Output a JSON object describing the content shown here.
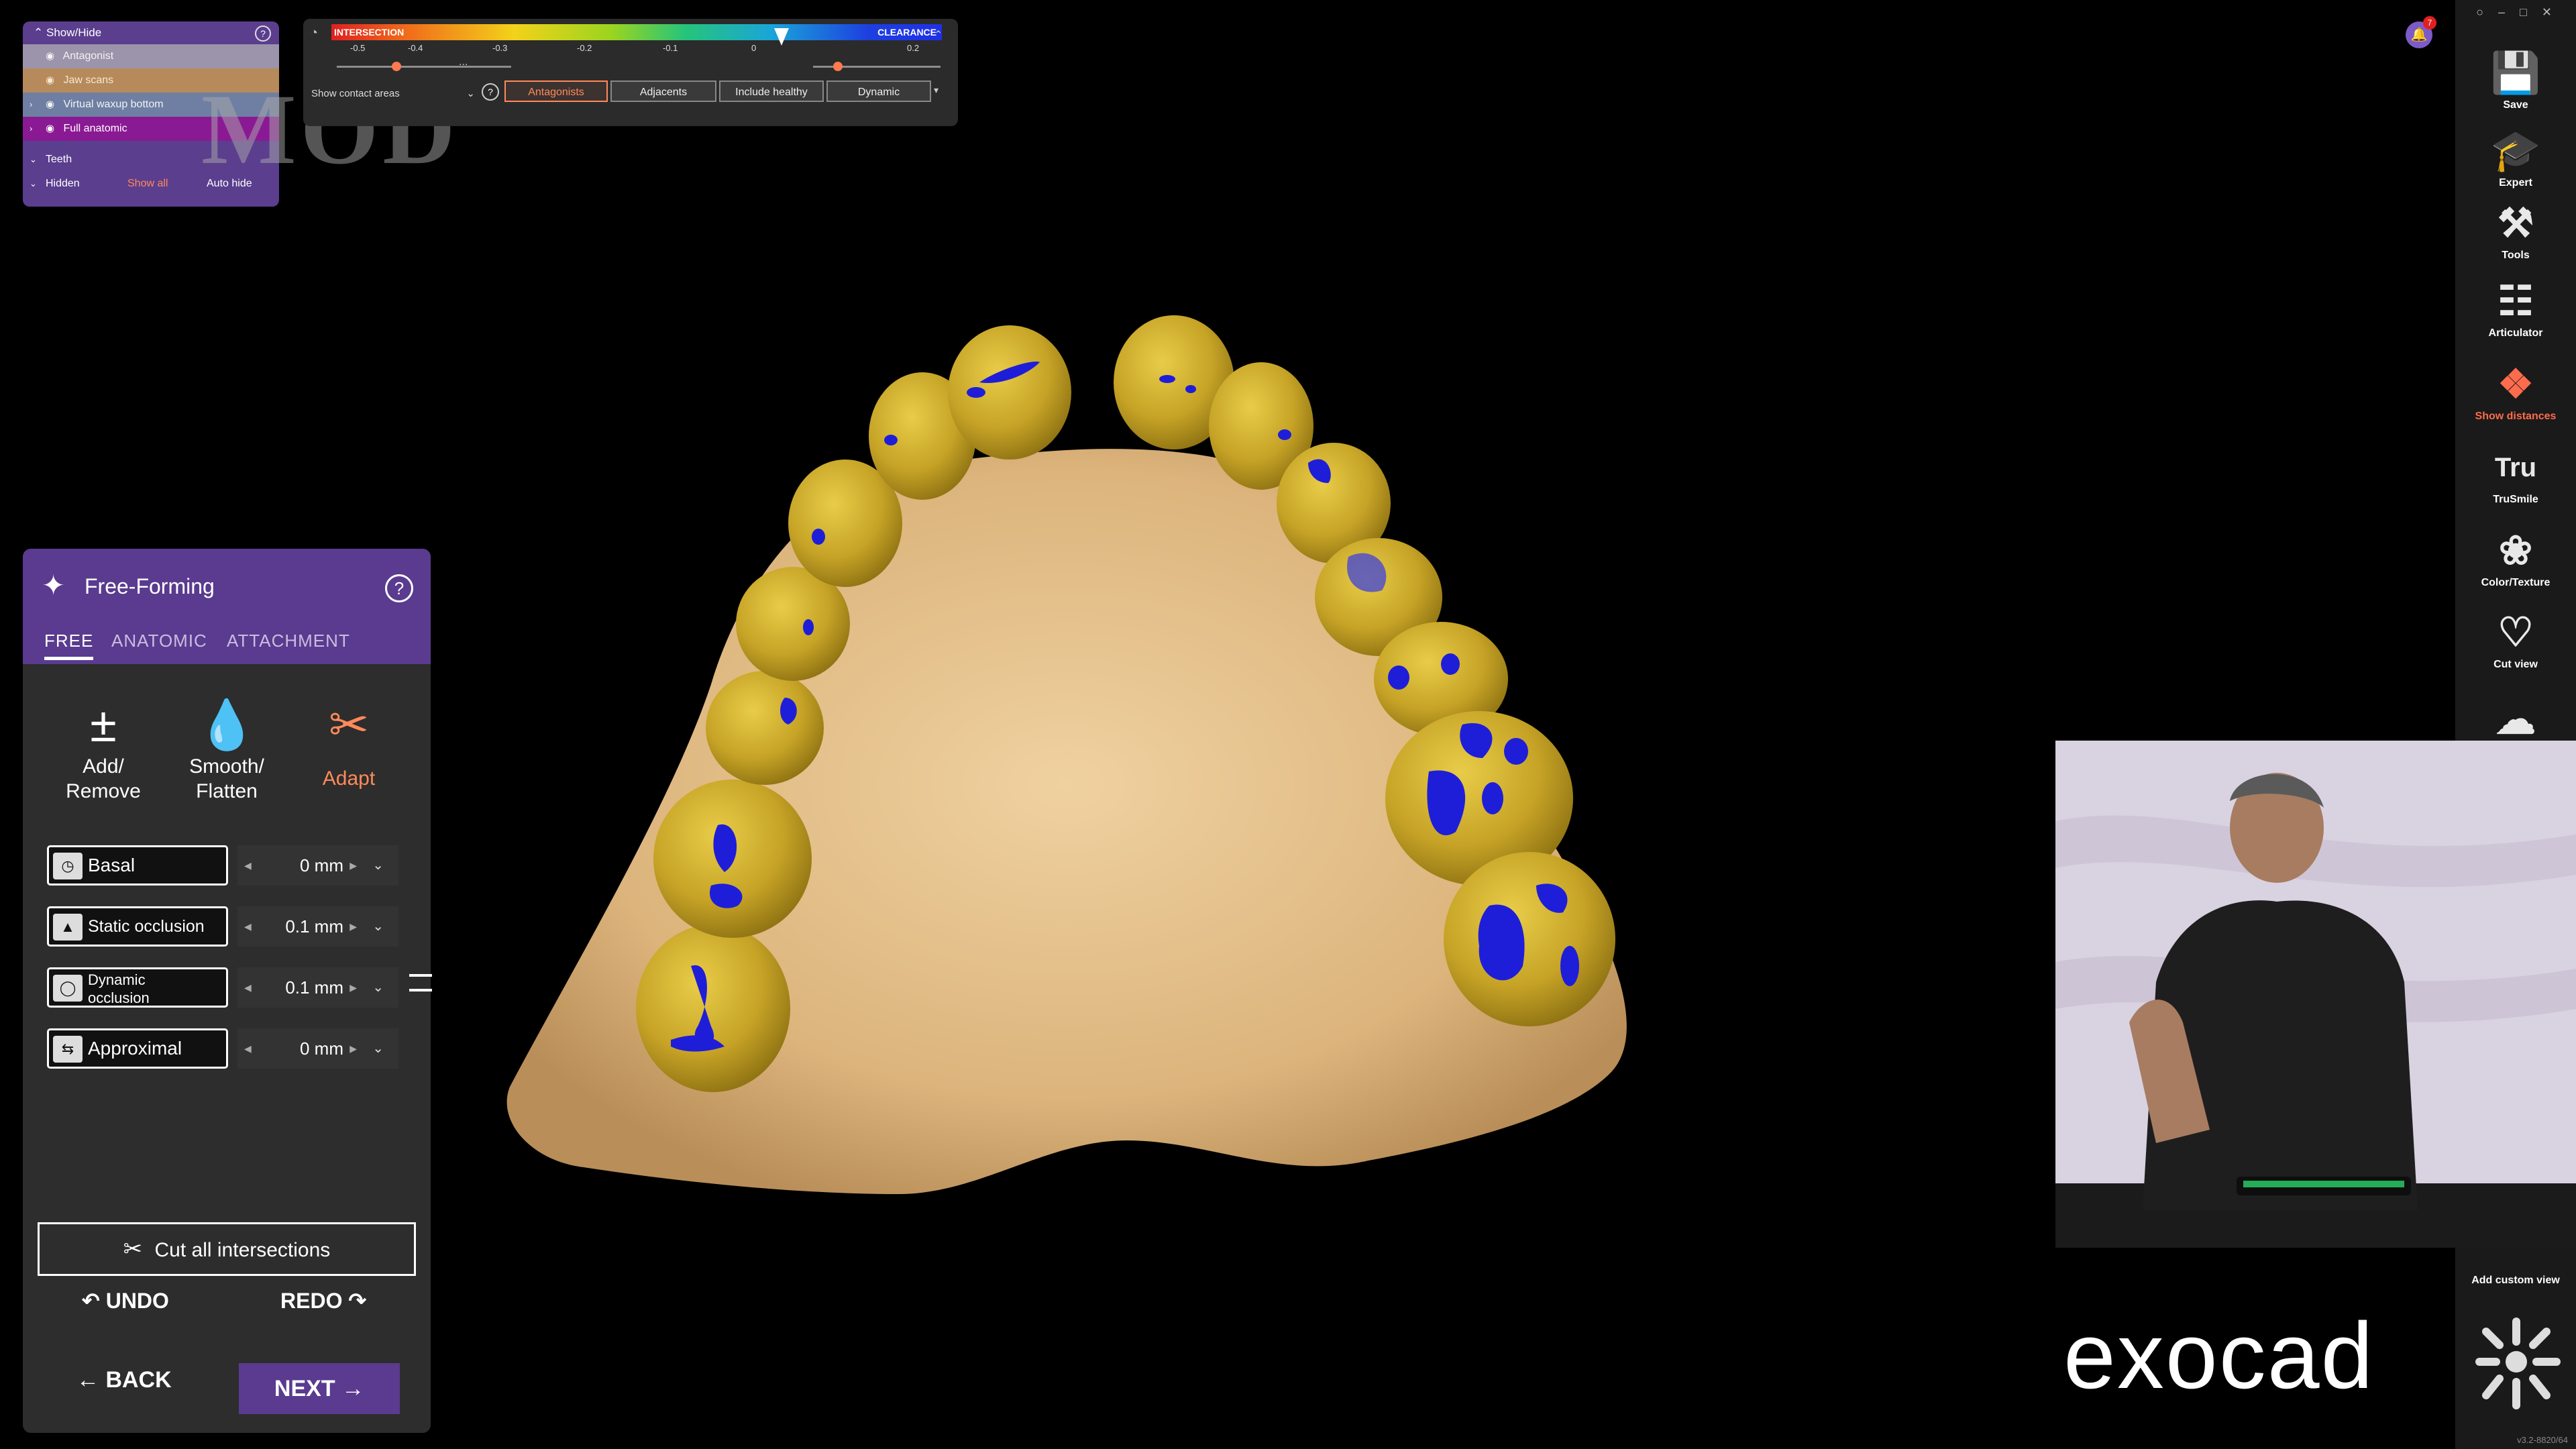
{
  "show_hide": {
    "title": "Show/Hide",
    "items": [
      {
        "label": "Antagonist"
      },
      {
        "label": "Jaw scans"
      },
      {
        "label": "Virtual waxup bottom"
      },
      {
        "label": "Full anatomic"
      }
    ],
    "teeth_label": "Teeth",
    "hidden_label": "Hidden",
    "show_all": "Show all",
    "auto_hide": "Auto hide"
  },
  "watermark": "MOD",
  "distance_bar": {
    "left_label": "INTERSECTION",
    "right_label": "CLEARANCE",
    "ticks": [
      "-0.5",
      "-0.4",
      "-0.3",
      "-0.2",
      "-0.1",
      "0",
      "0.2"
    ],
    "ellipsis": "...",
    "contact_select": "Show contact areas",
    "buttons": [
      "Antagonists",
      "Adjacents",
      "Include healthy",
      "Dynamic"
    ],
    "active_button": "Antagonists"
  },
  "free_forming": {
    "title": "Free-Forming",
    "tabs": [
      "FREE",
      "ANATOMIC",
      "ATTACHMENT"
    ],
    "active_tab": "FREE",
    "tools": [
      {
        "line1": "Add/",
        "line2": "Remove"
      },
      {
        "line1": "Smooth/",
        "line2": "Flatten"
      },
      {
        "line1": "Adapt",
        "line2": ""
      }
    ],
    "params": [
      {
        "label": "Basal",
        "value": "0 mm"
      },
      {
        "label": "Static occlusion",
        "value": "0.1 mm"
      },
      {
        "label_line1": "Dynamic",
        "label_line2": "occlusion",
        "value": "0.1 mm"
      },
      {
        "label": "Approximal",
        "value": "0 mm"
      }
    ],
    "cut_all": "Cut all intersections",
    "undo": "UNDO",
    "redo": "REDO",
    "back": "BACK",
    "next": "NEXT"
  },
  "right_toolbar": {
    "items": [
      {
        "label": "Save",
        "icon": "save-icon"
      },
      {
        "label": "Expert",
        "icon": "graduation-cap-icon"
      },
      {
        "label": "Tools",
        "icon": "tools-icon"
      },
      {
        "label": "Articulator",
        "icon": "articulator-icon"
      },
      {
        "label": "Show distances",
        "icon": "show-distances-icon"
      },
      {
        "label": "TruSmile",
        "icon": "trusmile-icon"
      },
      {
        "label": "Color/Texture",
        "icon": "color-texture-icon"
      },
      {
        "label": "Cut view",
        "icon": "cut-view-icon"
      }
    ],
    "highlight_color": "#ff6b4d",
    "add_custom_view": "Add custom view",
    "notification_count": "7",
    "version": "v3.2-8820/64"
  },
  "brand": {
    "logo": "exocad"
  },
  "colors": {
    "panel_purple": "#5a3b8f",
    "accent_orange": "#ff8a5a",
    "tooth_gold": "#c9a82a",
    "model_beige": "#e8c48f",
    "contact_blue": "#1e1ed8"
  }
}
